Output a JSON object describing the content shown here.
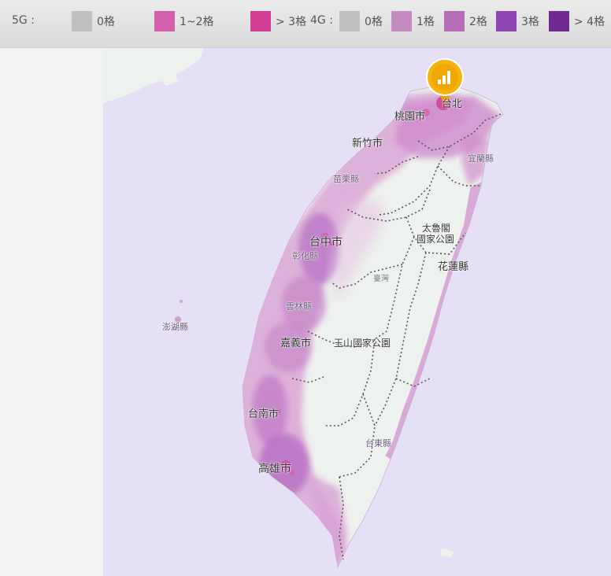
{
  "legend": {
    "g5": {
      "label": "5G :",
      "items": [
        {
          "label": "0格",
          "color": "#c0c0c0"
        },
        {
          "label": "1~2格",
          "color": "#d45fac"
        },
        {
          "label": "> 3格",
          "color": "#d33f97"
        }
      ]
    },
    "g4": {
      "label": "4G :",
      "items": [
        {
          "label": "0格",
          "color": "#c0c0c0"
        },
        {
          "label": "1格",
          "color": "#c68cc1"
        },
        {
          "label": "2格",
          "color": "#b56db8"
        },
        {
          "label": "3格",
          "color": "#8f48b3"
        },
        {
          "label": "> 4格",
          "color": "#6f2a93"
        }
      ]
    }
  },
  "map": {
    "sea_color": "#e5e0f5",
    "land_color": "#eef2ee",
    "labels": {
      "taoyuan": "桃園市",
      "taipei": "台北",
      "hsinchu": "新竹市",
      "yilan": "宜蘭縣",
      "miaoli": "苗栗縣",
      "taichung": "台中市",
      "changhua": "彰化縣",
      "taroko": "太魯閣",
      "taroko_park": "國家公園",
      "hualien": "花蓮縣",
      "taiwan": "臺灣",
      "yunlin": "雲林縣",
      "penghu": "澎湖縣",
      "chiayi": "嘉義市",
      "yushan": "玉山國家公園",
      "tainan": "台南市",
      "taitung": "台東縣",
      "kaohsiung": "高雄市"
    }
  }
}
